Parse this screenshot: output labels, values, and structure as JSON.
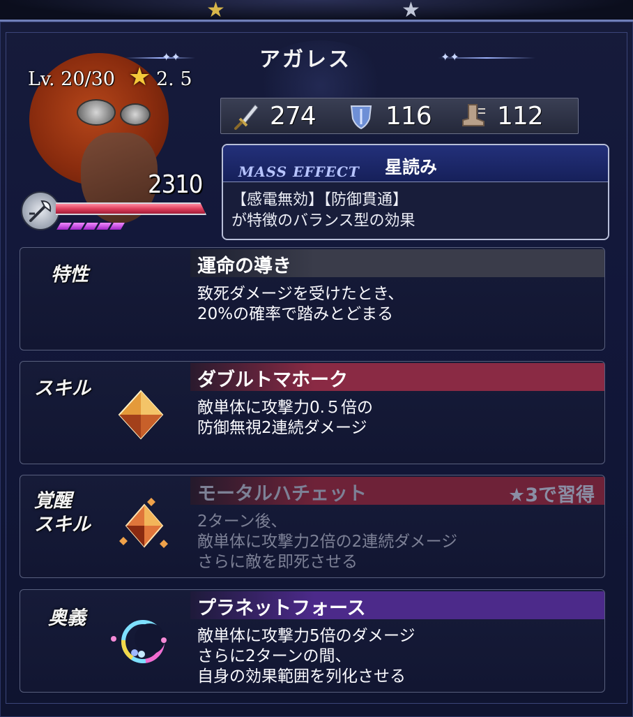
{
  "unit": {
    "name": "アガレス",
    "level_text": "Lv. 20/30",
    "rarity": "2. 5",
    "hp": "2310",
    "hp_fill_fraction": 1.0,
    "sp_pips": 5
  },
  "stats": [
    {
      "icon": "sword-icon",
      "value": "274"
    },
    {
      "icon": "shield-icon",
      "value": "116"
    },
    {
      "icon": "boot-icon",
      "value": "112"
    }
  ],
  "mass_effect": {
    "label": "MASS EFFECT",
    "name": "星読み",
    "desc_line1": "【感電無効】【防御貫通】",
    "desc_line2": "が特徴のバランス型の効果"
  },
  "rows": {
    "trait": {
      "label": "特性",
      "title": "運命の導き",
      "desc_line1": "致死ダメージを受けたとき、",
      "desc_line2": "20%の確率で踏みとどまる"
    },
    "skill": {
      "label": "スキル",
      "title": "ダブルトマホーク",
      "desc_line1": "敵単体に攻撃力0.５倍の",
      "desc_line2": "防御無視2連続ダメージ"
    },
    "awaken": {
      "label_line1": "覚醒",
      "label_line2": "スキル",
      "title": "モータルハチェット",
      "requirement": "★3で習得",
      "desc_line1": "2ターン後、",
      "desc_line2": "敵単体に攻撃力2倍の2連続ダメージ",
      "desc_line3": "さらに敵を即死させる"
    },
    "ougi": {
      "label": "奥義",
      "title": "プラネットフォース",
      "desc_line1": "敵単体に攻撃力5倍のダメージ",
      "desc_line2": "さらに2ターンの間、",
      "desc_line3": "自身の効果範囲を列化させる"
    }
  },
  "colors": {
    "trait_bar": "#3a3c4a",
    "skill_bar": "#8a2a44",
    "awaken_bar": "#6e2238",
    "ougi_bar": "#4c2a8a"
  }
}
